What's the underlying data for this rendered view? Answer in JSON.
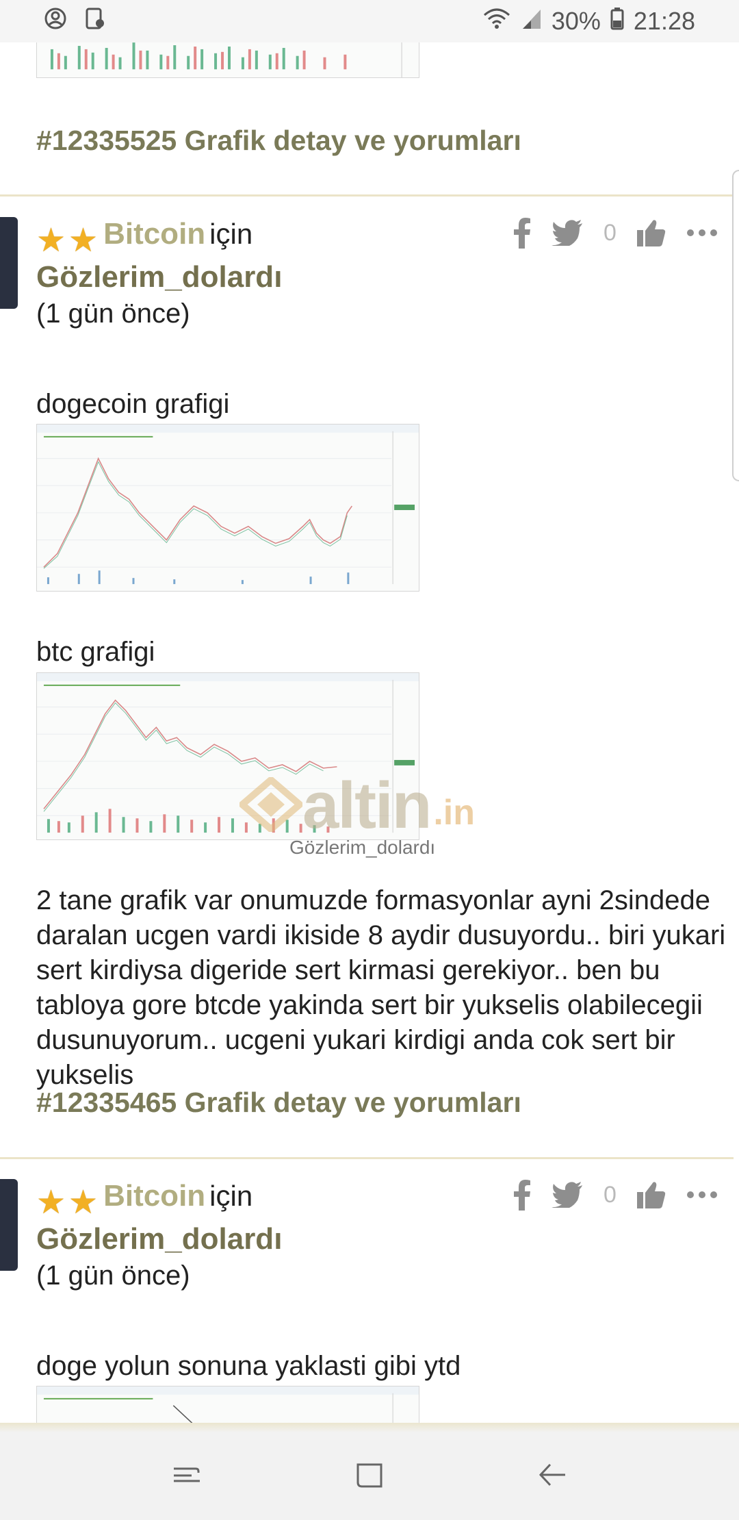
{
  "status_bar": {
    "battery": "30%",
    "time": "21:28"
  },
  "feed": {
    "top_link": "#12335525 Grafik detay ve yorumları",
    "posts": [
      {
        "coin": "Bitcoin",
        "coin_suffix": "için",
        "author": "Gözlerim_dolardı",
        "when": "(1 gün önce)",
        "like_count": "0",
        "caption_1": "dogecoin grafigi",
        "caption_2": "btc grafigi",
        "image_credit": "Gözlerim_dolardı",
        "body": "2 tane grafik var onumuzde formasyonlar ayni 2sindede daralan ucgen vardi ikiside 8 aydir dusuyordu.. biri yukari sert kirdiysa digeride sert kirmasi gerekiyor.. ben bu tabloya gore btcde yakinda sert bir yukselis olabilecegii dusunuyorum.. ucgeni yukari kirdigi anda cok sert bir yukselis",
        "detail_link": "#12335465 Grafik detay ve yorumları"
      },
      {
        "coin": "Bitcoin",
        "coin_suffix": "için",
        "author": "Gözlerim_dolardı",
        "when": "(1 gün önce)",
        "like_count": "0",
        "caption_1": "doge yolun sonuna yaklasti gibi ytd"
      }
    ]
  },
  "watermark": {
    "brand": "altin",
    "tld": ".in"
  },
  "icons": {
    "status_left": [
      "account-circle-icon",
      "screenshot-icon"
    ],
    "status_right": [
      "wifi-icon",
      "signal-icon",
      "battery-icon"
    ],
    "post_actions": [
      "facebook-icon",
      "twitter-icon",
      "thumbs-up-icon",
      "more-icon"
    ],
    "nav": [
      "recent-apps-icon",
      "home-icon",
      "back-icon"
    ]
  },
  "colors": {
    "coin_link": "#b1ad80",
    "author": "#74704e",
    "detail_link": "#7a7a58",
    "star": "#f2b024",
    "divider": "#ebe4c8"
  }
}
